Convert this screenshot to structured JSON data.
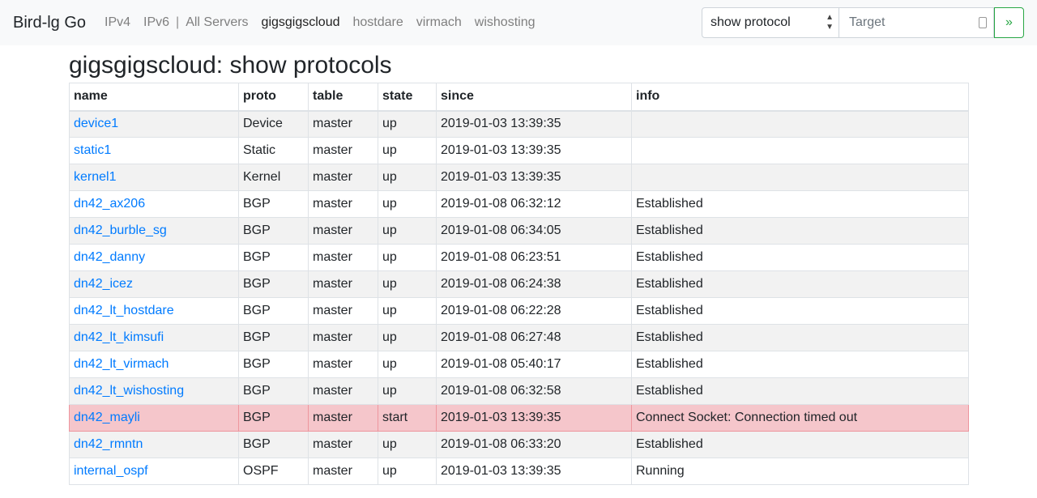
{
  "navbar": {
    "brand": "Bird-lg Go",
    "links": [
      "IPv4",
      "IPv6",
      "|",
      "All Servers",
      "gigsgigscloud",
      "hostdare",
      "virmach",
      "wishosting"
    ],
    "active": "gigsgigscloud",
    "select_value": "show protocol",
    "target_placeholder": "Target",
    "go_label": "»"
  },
  "page": {
    "title": "gigsgigscloud: show protocols"
  },
  "table": {
    "headers": [
      "name",
      "proto",
      "table",
      "state",
      "since",
      "info"
    ],
    "rows": [
      [
        "device1",
        "Device",
        "master",
        "up",
        "2019-01-03 13:39:35",
        ""
      ],
      [
        "static1",
        "Static",
        "master",
        "up",
        "2019-01-03 13:39:35",
        ""
      ],
      [
        "kernel1",
        "Kernel",
        "master",
        "up",
        "2019-01-03 13:39:35",
        ""
      ],
      [
        "dn42_ax206",
        "BGP",
        "master",
        "up",
        "2019-01-08 06:32:12",
        "Established"
      ],
      [
        "dn42_burble_sg",
        "BGP",
        "master",
        "up",
        "2019-01-08 06:34:05",
        "Established"
      ],
      [
        "dn42_danny",
        "BGP",
        "master",
        "up",
        "2019-01-08 06:23:51",
        "Established"
      ],
      [
        "dn42_icez",
        "BGP",
        "master",
        "up",
        "2019-01-08 06:24:38",
        "Established"
      ],
      [
        "dn42_lt_hostdare",
        "BGP",
        "master",
        "up",
        "2019-01-08 06:22:28",
        "Established"
      ],
      [
        "dn42_lt_kimsufi",
        "BGP",
        "master",
        "up",
        "2019-01-08 06:27:48",
        "Established"
      ],
      [
        "dn42_lt_virmach",
        "BGP",
        "master",
        "up",
        "2019-01-08 05:40:17",
        "Established"
      ],
      [
        "dn42_lt_wishosting",
        "BGP",
        "master",
        "up",
        "2019-01-08 06:32:58",
        "Established"
      ],
      [
        "dn42_mayli",
        "BGP",
        "master",
        "start",
        "2019-01-03 13:39:35",
        "Connect Socket: Connection timed out"
      ],
      [
        "dn42_rmntn",
        "BGP",
        "master",
        "up",
        "2019-01-08 06:33:20",
        "Established"
      ],
      [
        "internal_ospf",
        "OSPF",
        "master",
        "up",
        "2019-01-03 13:39:35",
        "Running"
      ]
    ],
    "danger_state": "start"
  },
  "colors": {
    "link": "#007bff",
    "danger_row": "#f5c6cb",
    "go_button": "#28a745"
  }
}
